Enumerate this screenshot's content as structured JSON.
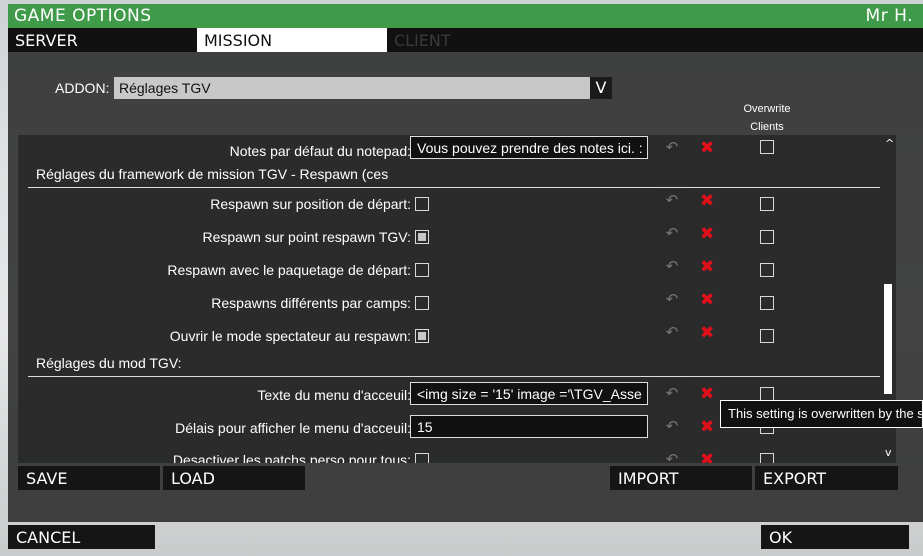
{
  "window": {
    "title": "GAME OPTIONS",
    "user": "Mr H."
  },
  "tabs": [
    {
      "label": "SERVER"
    },
    {
      "label": "MISSION"
    },
    {
      "label": "CLIENT"
    }
  ],
  "addon": {
    "label": "ADDON:",
    "selected": "Réglages TGV",
    "chevron": "V"
  },
  "columns": {
    "overwrite_line1": "Overwrite",
    "overwrite_line2": "Clients"
  },
  "rows": {
    "notepad": {
      "label": "Notes par défaut du notepad:",
      "value": "Vous pouvez prendre des notes ici. :"
    },
    "section_respawn": "Réglages du framework de mission TGV - Respawn (ces",
    "respawn_start": {
      "label": "Respawn sur position de départ:",
      "checked": false
    },
    "respawn_point": {
      "label": "Respawn sur point respawn TGV:",
      "checked": true
    },
    "respawn_loadout": {
      "label": "Respawn avec le paquetage de départ:",
      "checked": false
    },
    "respawn_sides": {
      "label": "Respawns différents par camps:",
      "checked": false
    },
    "spectator": {
      "label": "Ouvrir le mode spectateur au respawn:",
      "checked": true
    },
    "section_mod": "Réglages du mod TGV:",
    "welcome_text": {
      "label": "Texte du menu d'acceuil:",
      "value": "<img size = '15' image ='\\TGV_Asse"
    },
    "welcome_delay": {
      "label": "Délais pour afficher le menu d'acceuil:",
      "value": "15"
    },
    "disable_patches": {
      "label": "Desactiver les patchs perso pour tous:",
      "checked": false
    }
  },
  "icons": {
    "undo": "undo-icon",
    "reset": "reset-x-icon",
    "reset_glyph": "✖",
    "undo_glyph": "↶",
    "scroll_up": "^",
    "scroll_down": "v"
  },
  "tooltip": "This setting is overwritten by the s",
  "buttons": {
    "save": "SAVE",
    "load": "LOAD",
    "import": "IMPORT",
    "export": "EXPORT",
    "cancel": "CANCEL",
    "ok": "OK"
  },
  "colors": {
    "accent": "#3f9a4a",
    "reset": "#e0101b"
  }
}
